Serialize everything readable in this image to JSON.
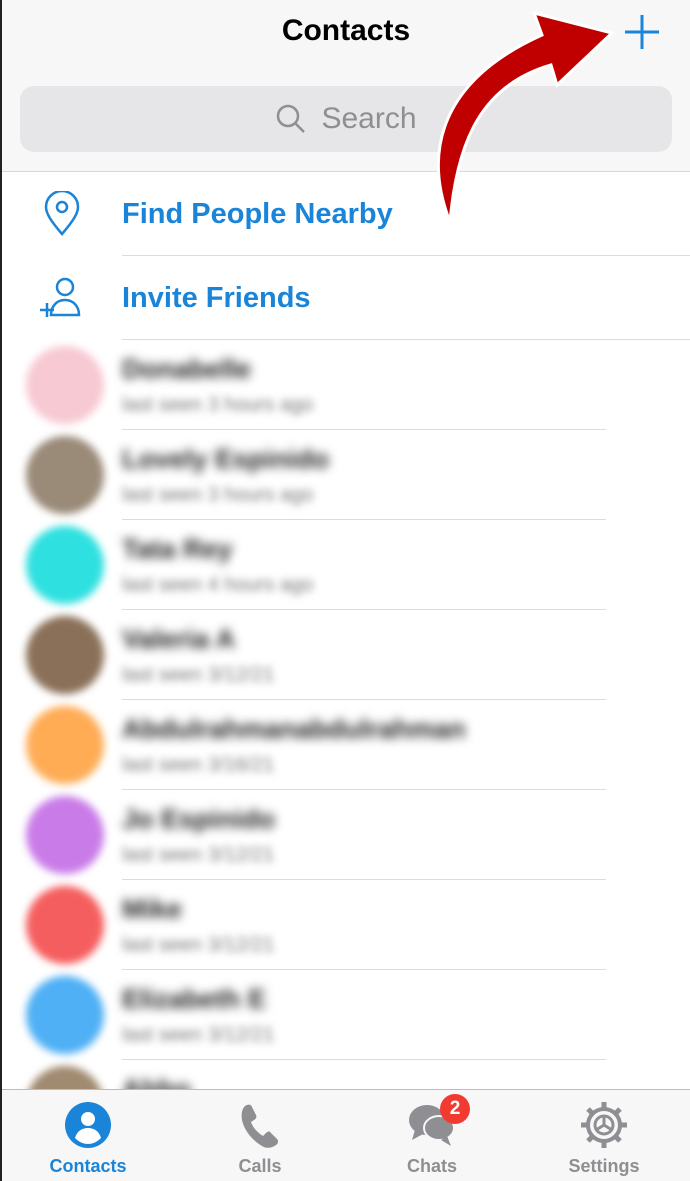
{
  "header": {
    "title": "Contacts",
    "add_icon": "plus-icon"
  },
  "search": {
    "placeholder": "Search"
  },
  "actions": [
    {
      "label": "Find People Nearby",
      "icon": "location-pin-icon"
    },
    {
      "label": "Invite Friends",
      "icon": "add-person-icon"
    }
  ],
  "contacts": [
    {
      "name": "Donabelle",
      "status": "last seen 3 hours ago",
      "color": "#f7c9d2"
    },
    {
      "name": "Lovely Espinido",
      "status": "last seen 3 hours ago",
      "color": "#9a8a78"
    },
    {
      "name": "Tata Rey",
      "status": "last seen 4 hours ago",
      "color": "#2fe0e0"
    },
    {
      "name": "Valeria A",
      "status": "last seen 3/12/21",
      "color": "#8a7058"
    },
    {
      "name": "Abdulrahmanabdulrahman",
      "status": "last seen 3/16/21",
      "color": "#ffac55"
    },
    {
      "name": "Jo Espinido",
      "status": "last seen 3/12/21",
      "color": "#c97ce8"
    },
    {
      "name": "Mike",
      "status": "last seen 3/12/21",
      "color": "#f55e5e"
    },
    {
      "name": "Elizabeth E",
      "status": "last seen 3/12/21",
      "color": "#4fb0f5"
    },
    {
      "name": "Abbo",
      "status": "",
      "color": "#a08a70"
    }
  ],
  "tabs": [
    {
      "label": "Contacts",
      "icon": "person-icon",
      "active": true
    },
    {
      "label": "Calls",
      "icon": "phone-icon"
    },
    {
      "label": "Chats",
      "icon": "chat-bubbles-icon",
      "badge": "2"
    },
    {
      "label": "Settings",
      "icon": "gear-icon"
    }
  ],
  "colors": {
    "accent": "#1a84d8",
    "badge": "#f23a30",
    "annotation_arrow": "#c00000"
  }
}
